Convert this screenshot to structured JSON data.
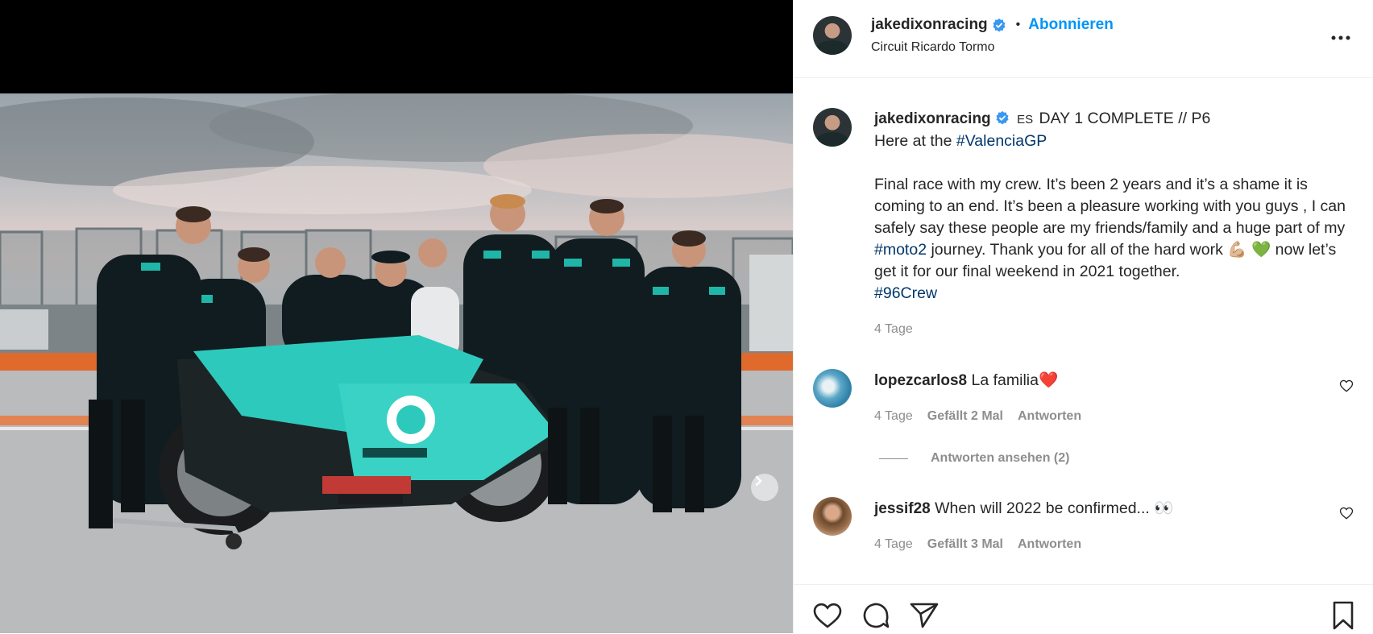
{
  "header": {
    "username": "jakedixonracing",
    "separator": "•",
    "follow_label": "Abonnieren",
    "location": "Circuit Ricardo Tormo"
  },
  "caption": {
    "username": "jakedixonracing",
    "flag": "ES",
    "line1": "DAY 1 COMPLETE // P6",
    "line2_prefix": "Here at the ",
    "hashtag_valencia": "#ValenciaGP",
    "para_a": "Final race with my crew. It’s been 2 years and it’s a shame it is coming to an end. It’s been a pleasure working with you guys , I can safely say these people are my friends/family and a huge part of my ",
    "hashtag_moto2": "#moto2",
    "para_b": " journey. Thank you for all of the hard work ",
    "emoji_1": "💪🏼",
    "emoji_2": "💚",
    "para_c": " now let’s get it for our final weekend in 2021 together.",
    "hashtag_crew": "#96Crew",
    "time": "4 Tage"
  },
  "comments": [
    {
      "username": "lopezcarlos8",
      "text": "La familia",
      "emoji": "❤️",
      "time": "4 Tage",
      "likes": "Gefällt 2 Mal",
      "reply_label": "Antworten"
    },
    {
      "username": "jessif28",
      "text": "When will 2022 be confirmed...",
      "emoji": "👀",
      "time": "4 Tage",
      "likes": "Gefällt 3 Mal",
      "reply_label": "Antworten"
    }
  ],
  "view_replies": "Antworten ansehen (2)",
  "colors": {
    "accent": "#0095f6",
    "hashtag": "#00376b",
    "muted": "#8e8e8e",
    "text": "#262626"
  },
  "icons": {
    "more": "more-dots-icon",
    "verified": "verified-badge-icon",
    "like": "heart-icon",
    "comment": "comment-bubble-icon",
    "share": "paper-plane-icon",
    "save": "bookmark-icon",
    "next": "chevron-right-icon"
  }
}
